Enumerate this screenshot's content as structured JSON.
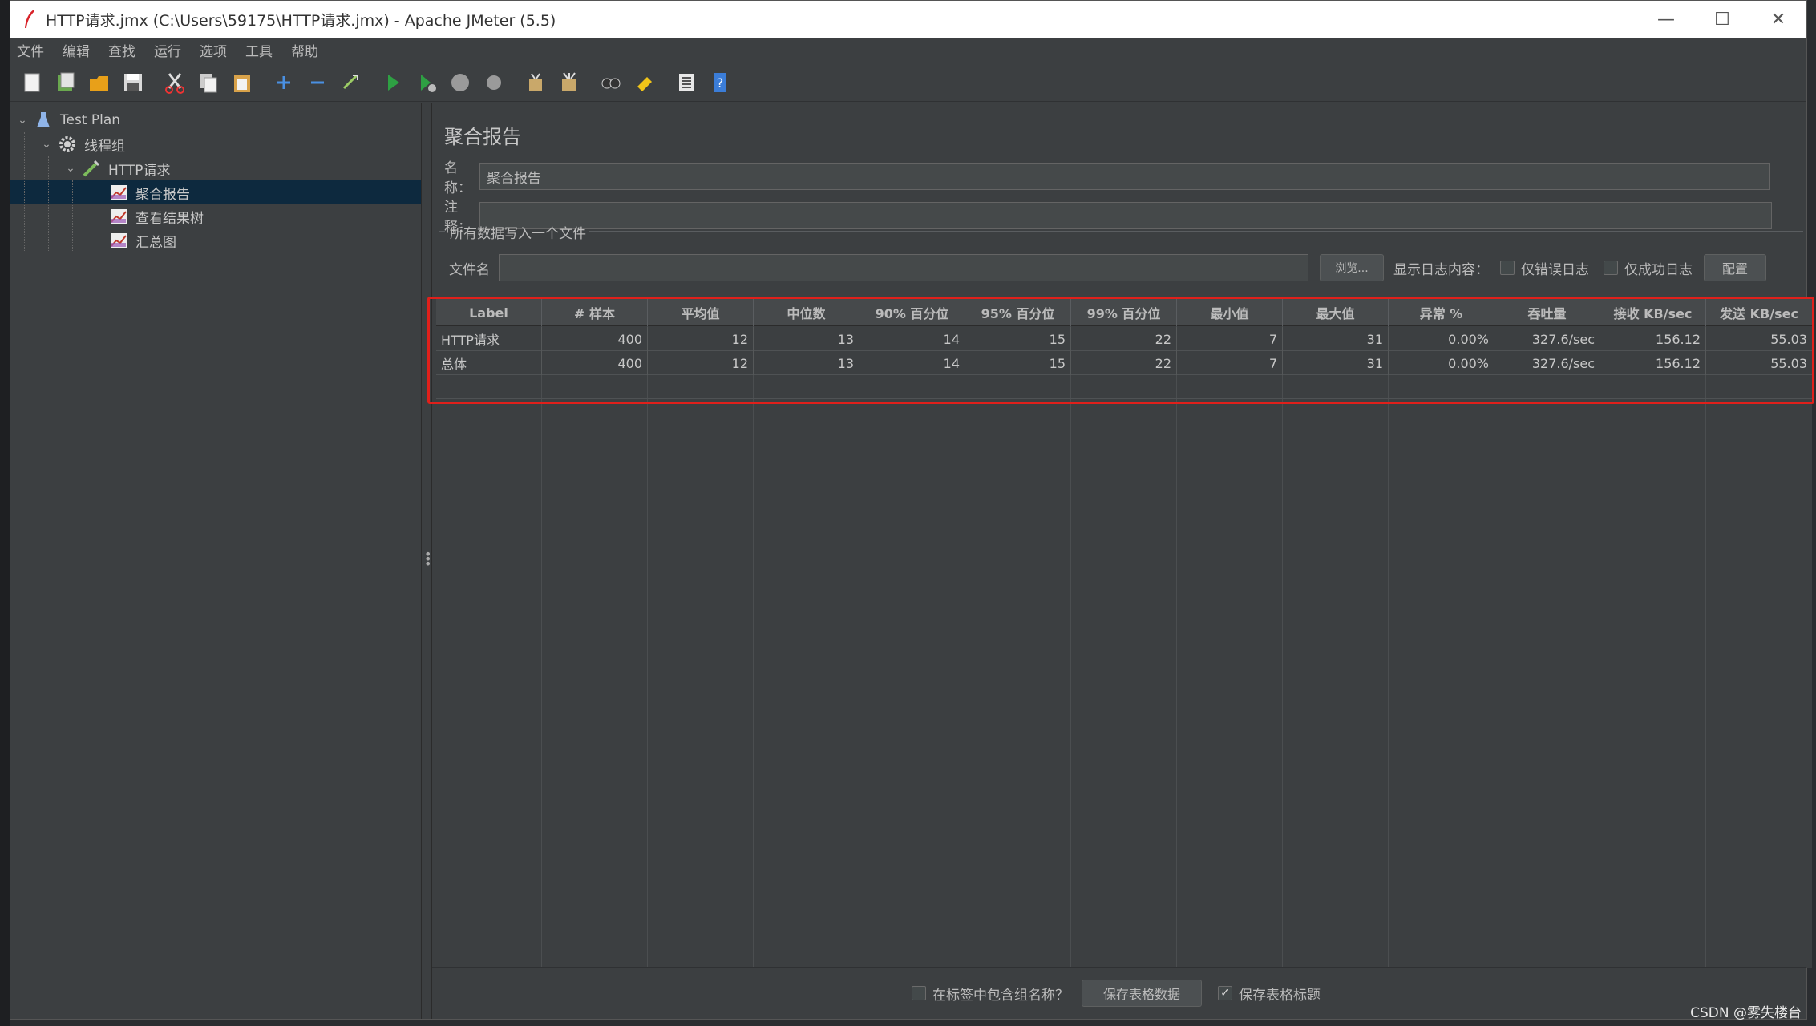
{
  "window": {
    "title": "HTTP请求.jmx (C:\\Users\\59175\\HTTP请求.jmx) - Apache JMeter (5.5)",
    "minimize": "—",
    "maximize": "☐",
    "close": "✕"
  },
  "menu": [
    "文件",
    "编辑",
    "查找",
    "运行",
    "选项",
    "工具",
    "帮助"
  ],
  "toolbar_icons": [
    "new-icon",
    "templates-icon",
    "open-icon",
    "save-icon",
    "cut-icon",
    "copy-icon",
    "paste-icon",
    "expand-icon",
    "collapse-icon",
    "toggle-icon",
    "start-icon",
    "start-no-pause-icon",
    "stop-icon",
    "shutdown-icon",
    "clear-icon",
    "clear-all-icon",
    "search-icon",
    "reset-search-icon",
    "function-helper-icon",
    "help-icon"
  ],
  "tree": [
    {
      "label": "Test Plan",
      "level": 0,
      "expanded": true
    },
    {
      "label": "线程组",
      "level": 1,
      "expanded": true
    },
    {
      "label": "HTTP请求",
      "level": 2,
      "expanded": true
    },
    {
      "label": "聚合报告",
      "level": 3,
      "selected": true
    },
    {
      "label": "查看结果树",
      "level": 3
    },
    {
      "label": "汇总图",
      "level": 3
    }
  ],
  "panel": {
    "title": "聚合报告",
    "name_label": "名称：",
    "name_value": "聚合报告",
    "comment_label": "注释：",
    "comment_value": "",
    "group_legend": "所有数据写入一个文件",
    "filename_label": "文件名",
    "filename_value": "",
    "browse_button": "浏览...",
    "log_content_label": "显示日志内容：",
    "errors_only": "仅错误日志",
    "success_only": "仅成功日志",
    "configure_button": "配置"
  },
  "table": {
    "headers": [
      "Label",
      "# 样本",
      "平均值",
      "中位数",
      "90% 百分位",
      "95% 百分位",
      "99% 百分位",
      "最小值",
      "最大值",
      "异常 %",
      "吞吐量",
      "接收 KB/sec",
      "发送 KB/sec"
    ],
    "rows": [
      [
        "HTTP请求",
        "400",
        "12",
        "13",
        "14",
        "15",
        "22",
        "7",
        "31",
        "0.00%",
        "327.6/sec",
        "156.12",
        "55.03"
      ],
      [
        "总体",
        "400",
        "12",
        "13",
        "14",
        "15",
        "22",
        "7",
        "31",
        "0.00%",
        "327.6/sec",
        "156.12",
        "55.03"
      ]
    ]
  },
  "bottom": {
    "include_group_label": "在标签中包含组名称？",
    "include_group_checked": false,
    "save_table_button": "保存表格数据",
    "save_header_label": "保存表格标题",
    "save_header_checked": true
  },
  "watermark": "CSDN @雾失楼台",
  "colors": {
    "highlight_box": "#e0201b",
    "selection": "#0d293e",
    "background": "#3c3f41"
  }
}
